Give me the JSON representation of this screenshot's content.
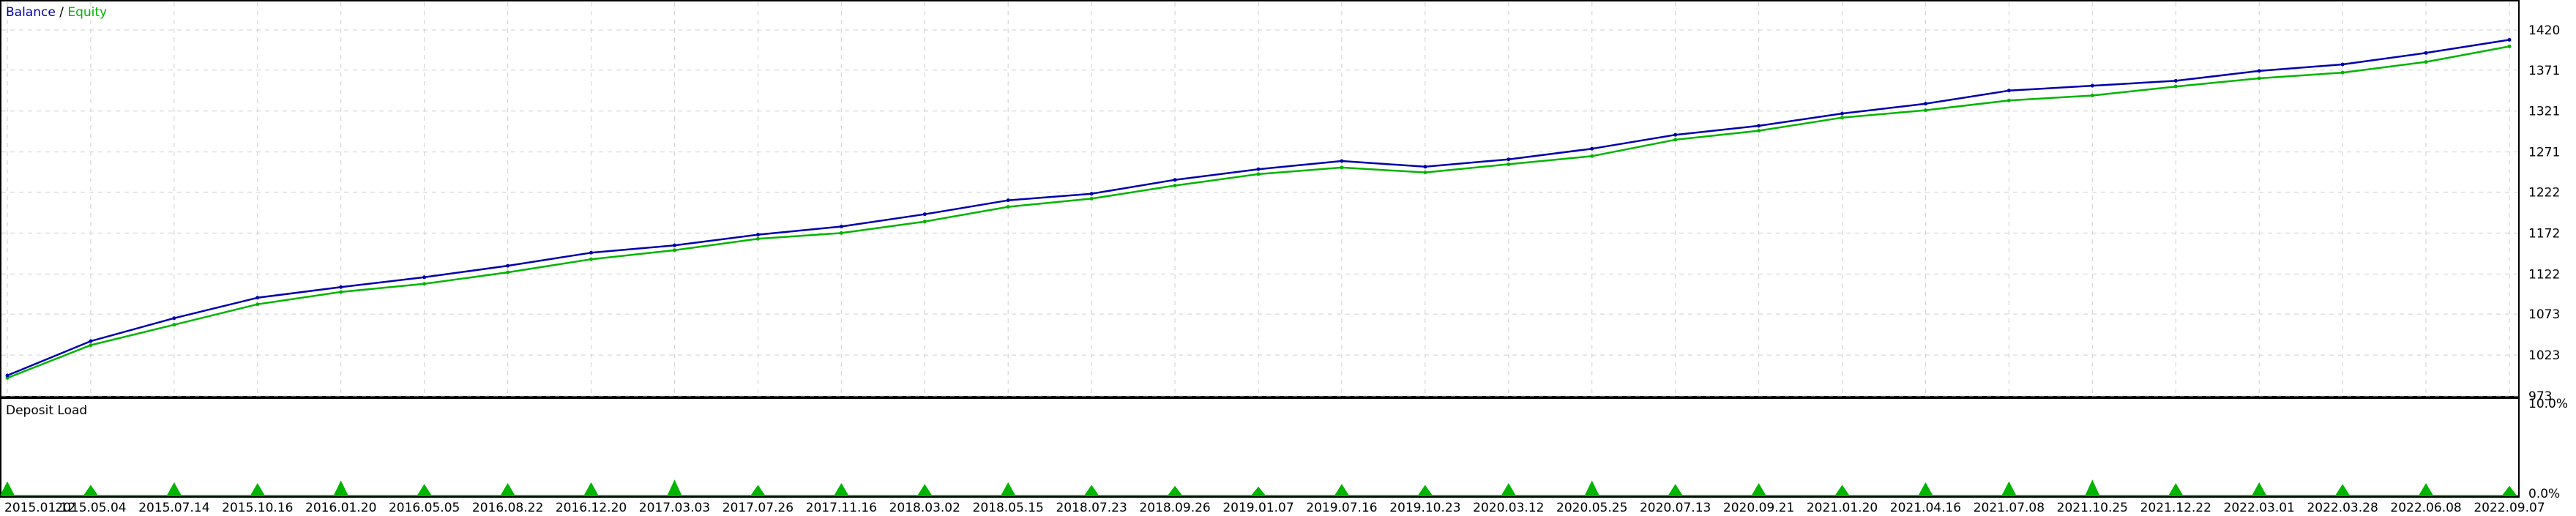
{
  "colors": {
    "balance": "#0000aa",
    "equity": "#00b400",
    "deposit_load": "#00b400",
    "grid": "#d0d0d0",
    "frame": "#000000",
    "background": "#ffffff"
  },
  "chart_data": [
    {
      "type": "line",
      "legend": {
        "balance_label": "Balance",
        "separator": " / ",
        "equity_label": "Equity",
        "placement": "top-left"
      },
      "x_ticks": [
        "2015.01.12",
        "2015.05.04",
        "2015.07.14",
        "2015.10.16",
        "2016.01.20",
        "2016.05.05",
        "2016.08.22",
        "2016.12.20",
        "2017.03.03",
        "2017.07.26",
        "2017.11.16",
        "2018.03.02",
        "2018.05.15",
        "2018.07.23",
        "2018.09.26",
        "2019.01.07",
        "2019.07.16",
        "2019.10.23",
        "2020.03.12",
        "2020.05.25",
        "2020.07.13",
        "2020.09.21",
        "2021.01.20",
        "2021.04.16",
        "2021.07.08",
        "2021.10.25",
        "2021.12.22",
        "2022.03.01",
        "2022.03.28",
        "2022.06.08",
        "2022.09.07"
      ],
      "y_ticks": [
        973,
        1023,
        1073,
        1122,
        1172,
        1222,
        1271,
        1321,
        1371,
        1420
      ],
      "ylim": [
        973,
        1420
      ],
      "grid": true,
      "series": [
        {
          "name": "Balance",
          "x": [
            "2015.01.12",
            "2015.05.04",
            "2015.07.14",
            "2015.10.16",
            "2016.01.20",
            "2016.05.05",
            "2016.08.22",
            "2016.12.20",
            "2017.03.03",
            "2017.07.26",
            "2017.11.16",
            "2018.03.02",
            "2018.05.15",
            "2018.07.23",
            "2018.09.26",
            "2019.01.07",
            "2019.07.16",
            "2019.10.23",
            "2020.03.12",
            "2020.05.25",
            "2020.07.13",
            "2020.09.21",
            "2021.01.20",
            "2021.04.16",
            "2021.07.08",
            "2021.10.25",
            "2021.12.22",
            "2022.03.01",
            "2022.03.28",
            "2022.06.08",
            "2022.09.07"
          ],
          "y": [
            998,
            1040,
            1068,
            1093,
            1106,
            1118,
            1132,
            1148,
            1157,
            1170,
            1180,
            1195,
            1212,
            1220,
            1237,
            1250,
            1260,
            1253,
            1262,
            1275,
            1292,
            1303,
            1318,
            1330,
            1346,
            1352,
            1358,
            1370,
            1378,
            1392,
            1408
          ]
        },
        {
          "name": "Equity",
          "x": [
            "2015.01.12",
            "2015.05.04",
            "2015.07.14",
            "2015.10.16",
            "2016.01.20",
            "2016.05.05",
            "2016.08.22",
            "2016.12.20",
            "2017.03.03",
            "2017.07.26",
            "2017.11.16",
            "2018.03.02",
            "2018.05.15",
            "2018.07.23",
            "2018.09.26",
            "2019.01.07",
            "2019.07.16",
            "2019.10.23",
            "2020.03.12",
            "2020.05.25",
            "2020.07.13",
            "2020.09.21",
            "2021.01.20",
            "2021.04.16",
            "2021.07.08",
            "2021.10.25",
            "2021.12.22",
            "2022.03.01",
            "2022.03.28",
            "2022.06.08",
            "2022.09.07"
          ],
          "y": [
            995,
            1035,
            1060,
            1085,
            1100,
            1110,
            1124,
            1140,
            1151,
            1165,
            1172,
            1186,
            1204,
            1214,
            1230,
            1244,
            1252,
            1246,
            1256,
            1266,
            1286,
            1297,
            1313,
            1322,
            1334,
            1340,
            1351,
            1361,
            1368,
            1381,
            1400
          ]
        }
      ]
    },
    {
      "type": "area",
      "title": "Deposit Load",
      "y_ticks": [
        "10.0%",
        "0.0%"
      ],
      "ylim": [
        0,
        10
      ],
      "grid": false,
      "series": [
        {
          "name": "Deposit Load",
          "x": [
            "2015.01.12",
            "2015.05.04",
            "2015.07.14",
            "2015.10.16",
            "2016.01.20",
            "2016.05.05",
            "2016.08.22",
            "2016.12.20",
            "2017.03.03",
            "2017.07.26",
            "2017.11.16",
            "2018.03.02",
            "2018.05.15",
            "2018.07.23",
            "2018.09.26",
            "2019.01.07",
            "2019.07.16",
            "2019.10.23",
            "2020.03.12",
            "2020.05.25",
            "2020.07.13",
            "2020.09.21",
            "2021.01.20",
            "2021.04.16",
            "2021.07.08",
            "2021.10.25",
            "2021.12.22",
            "2022.03.01",
            "2022.03.28",
            "2022.06.08",
            "2022.09.07"
          ],
          "y": [
            1.6,
            1.2,
            1.5,
            1.4,
            1.7,
            1.3,
            1.4,
            1.5,
            1.8,
            1.2,
            1.4,
            1.3,
            1.5,
            1.2,
            1.1,
            1.0,
            1.3,
            1.2,
            1.4,
            1.7,
            1.3,
            1.4,
            1.2,
            1.5,
            1.6,
            1.8,
            1.4,
            1.5,
            1.3,
            1.4,
            1.1
          ]
        }
      ]
    }
  ]
}
